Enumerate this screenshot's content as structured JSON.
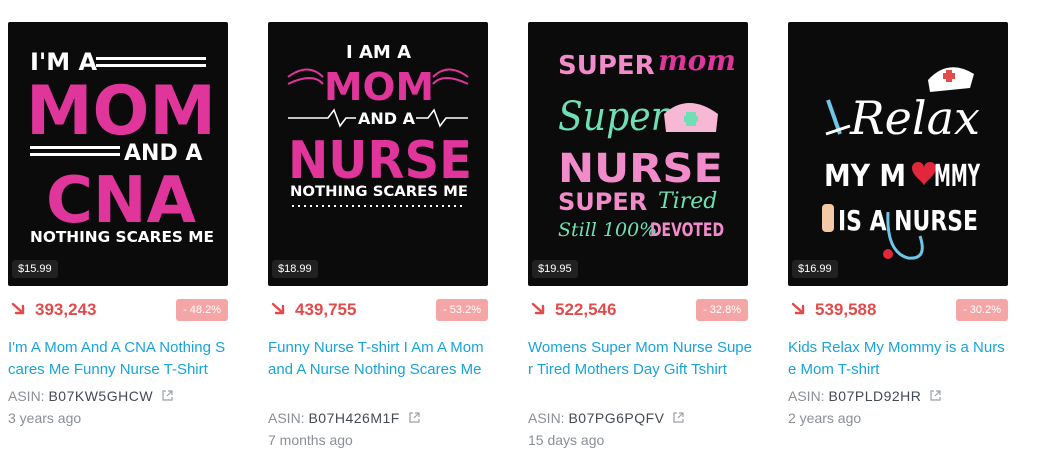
{
  "products": [
    {
      "price": "$15.99",
      "rank": "393,243",
      "change": "- 48.2%",
      "title": "I'm A Mom And A CNA Nothing Scares Me Funny Nurse T-Shirt",
      "asin_label": "ASIN:",
      "asin": "B07KW5GHCW",
      "age": "3 years ago",
      "art": {
        "l1": "I'M A",
        "l2": "MOM",
        "l3": "AND A",
        "l4": "CNA",
        "l5": "NOTHING SCARES ME"
      }
    },
    {
      "price": "$18.99",
      "rank": "439,755",
      "change": "- 53.2%",
      "title": "Funny Nurse T-shirt I Am A Mom and A Nurse Nothing Scares Me",
      "asin_label": "ASIN:",
      "asin": "B07H426M1F",
      "age": "7 months ago",
      "art": {
        "l1": "I AM A",
        "l2": "MOM",
        "l3": "AND A",
        "l4": "NURSE",
        "l5": "NOTHING SCARES ME"
      }
    },
    {
      "price": "$19.95",
      "rank": "522,546",
      "change": "- 32.8%",
      "title": "Womens Super Mom Nurse Super Tired Mothers Day Gift Tshirt",
      "asin_label": "ASIN:",
      "asin": "B07PG6PQFV",
      "age": "15 days ago",
      "art": {
        "l1": "SUPER",
        "l1b": "mom",
        "l2": "Super",
        "l3": "NURSE",
        "l4": "SUPER",
        "l4b": "Tired",
        "l5": "Still 100%",
        "l5b": "DEVOTED"
      }
    },
    {
      "price": "$16.99",
      "rank": "539,588",
      "change": "- 30.2%",
      "title": "Kids Relax My Mommy is a Nurse Mom T-shirt",
      "asin_label": "ASIN:",
      "asin": "B07PLD92HR",
      "age": "2 years ago",
      "art": {
        "l1": "Relax",
        "l2": "MY M",
        "l2b": "MMY",
        "l3": "IS A NURSE"
      }
    }
  ],
  "colors": {
    "rank": "#e24b4b",
    "badge": "#f4a6a6",
    "link": "#1aa3d8",
    "muted": "#8a8f96",
    "art_pink": "#e0359a",
    "art_light_pink": "#f28bc9",
    "art_mint": "#6fe0b5"
  },
  "icons": {
    "trend": "trend-down-arrow-icon",
    "external": "external-link-icon"
  }
}
